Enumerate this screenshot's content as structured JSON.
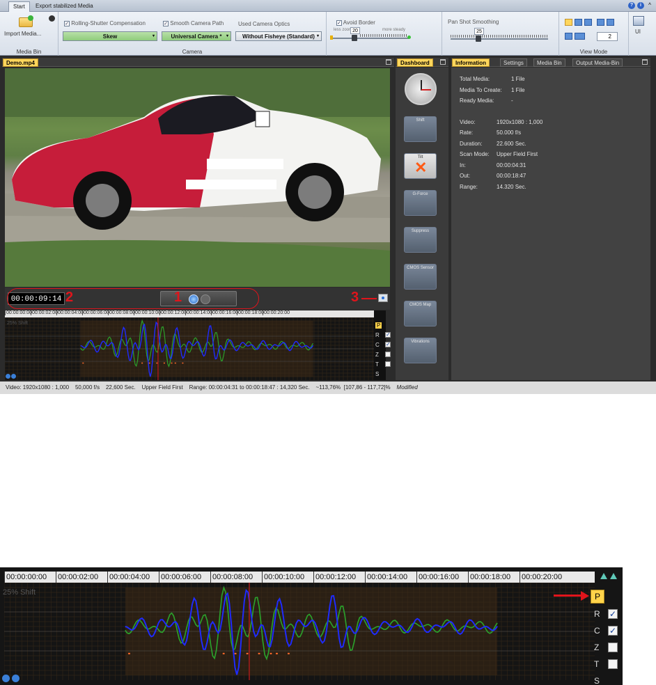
{
  "ribbon": {
    "tabs": [
      "Start",
      "Export stabilized Media"
    ],
    "window_buttons": [
      "?",
      "i",
      "^"
    ],
    "media_bin": {
      "import_label": "Import Media...",
      "group_label": "Media Bin"
    },
    "camera": {
      "rolling_shutter_label": "Rolling-Shutter Compensation",
      "smooth_path_label": "Smooth Camera Path",
      "optics_label": "Used Camera Optics",
      "rs_value": "Skew",
      "path_value": "Universal Camera *",
      "optics_value": "Without Fisheye (Standard)",
      "group_label": "Camera"
    },
    "avoid_border": {
      "label": "Avoid Border",
      "value": "20",
      "left_caption": "less zoom",
      "right_caption": "more steady"
    },
    "pan_shot": {
      "label": "Pan Shot Smoothing",
      "value": "25"
    },
    "view_mode": {
      "label": "View Mode",
      "value": "2"
    },
    "ui_label": "UI"
  },
  "video_panel": {
    "tab": "Demo.mp4",
    "timecode": "00:00:09:14"
  },
  "annotations": {
    "n1": "1",
    "n2": "2",
    "n3": "3"
  },
  "timeline": {
    "ticks": [
      "00:00:00:00",
      "00:00:02:00",
      "00:00:04:00",
      "00:00:06:00",
      "00:00:08:00",
      "00:00:10:00",
      "00:00:12:00",
      "00:00:14:00",
      "00:00:16:00",
      "00:00:18:00",
      "00:00:20:00"
    ],
    "shift_label": "25% Shift",
    "side_letters": [
      "P",
      "R",
      "C",
      "Z",
      "T",
      "S"
    ],
    "checked": [
      false,
      true,
      true,
      false,
      false,
      false
    ]
  },
  "dashboard": {
    "tab": "Dashboard",
    "gadgets": [
      "Shift",
      "Tilt",
      "G-Force",
      "Suppress",
      "CMOS Sensor",
      "CMOS Map",
      "Vibrations"
    ]
  },
  "info": {
    "tabs": [
      "Information",
      "Settings",
      "Media Bin",
      "Output Media-Bin"
    ],
    "rows": [
      {
        "k": "Total Media:",
        "v": "1 File"
      },
      {
        "k": "Media To Create:",
        "v": "1 File"
      },
      {
        "k": "Ready Media:",
        "v": "-"
      },
      {
        "k": "Video:",
        "v": "1920x1080 : 1,000"
      },
      {
        "k": "Rate:",
        "v": "50.000 f/s"
      },
      {
        "k": "Duration:",
        "v": "22.600 Sec."
      },
      {
        "k": "Scan Mode:",
        "v": "Upper Field First"
      },
      {
        "k": "In:",
        "v": "00:00:04:31"
      },
      {
        "k": "Out:",
        "v": "00:00:18:47"
      },
      {
        "k": "Range:",
        "v": "14.320 Sec."
      }
    ]
  },
  "status": {
    "video": "Video: 1920x1080 : 1,000",
    "rate": "50,000 f/s",
    "duration": "22,600 Sec.",
    "scan": "Upper Field First",
    "range": "Range: 00:00:04:31 to 00:00:18:47 : 14,320 Sec.",
    "zoom": "~113,76%",
    "zoom_range": "[107,86 - 117,72]%",
    "modified": "Modified"
  },
  "colors": {
    "accent": "#ffd65c",
    "red": "#e0141b",
    "blue": "#1f2bff",
    "green": "#2ba02b"
  }
}
